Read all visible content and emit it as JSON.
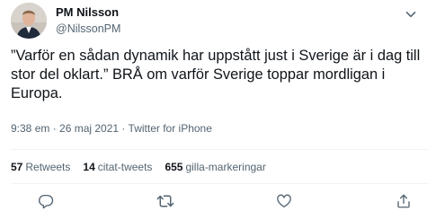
{
  "author": {
    "display_name": "PM Nilsson",
    "handle": "@NilssonPM"
  },
  "tweet": {
    "text": "”Varför en sådan dynamik har uppstått just i Sverige är i dag till stor del oklart.” BRÅ om varför Sverige toppar mordligan i Europa.",
    "time": "9:38 em",
    "separator": " · ",
    "date": "26 maj 2021",
    "source": "Twitter for iPhone"
  },
  "stats": {
    "retweets_count": "57",
    "retweets_label": "Retweets",
    "quotes_count": "14",
    "quotes_label": "citat-tweets",
    "likes_count": "655",
    "likes_label": "gilla-markeringar"
  },
  "icons": {
    "more": "chevron-down-icon",
    "reply": "reply-icon",
    "retweet": "retweet-icon",
    "like": "heart-icon",
    "share": "share-icon"
  },
  "colors": {
    "text_primary": "#0f1419",
    "text_secondary": "#536471",
    "divider": "#eff3f4"
  }
}
